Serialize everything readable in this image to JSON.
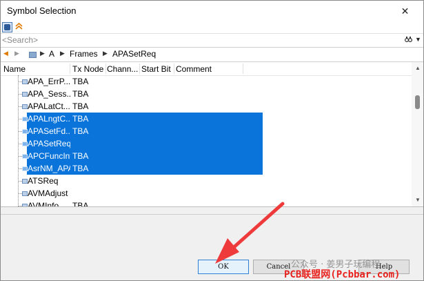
{
  "window": {
    "title": "Symbol Selection",
    "close_glyph": "✕"
  },
  "toolbar": {
    "icons": [
      "database-icon",
      "double-chevron-up-icon"
    ],
    "btn2_glyph": "≈"
  },
  "search": {
    "placeholder": "<Search>",
    "binoculars_glyph": "🔍",
    "dropdown_glyph": "▼"
  },
  "nav": {
    "back_glyph": "◀",
    "forward_glyph": "▶",
    "sep_glyph": "▶",
    "breadcrumb": [
      "A",
      "Frames",
      "APASetReq"
    ]
  },
  "columns": [
    "Name",
    "Tx Node",
    "Chann...",
    "Start Bit",
    "Comment"
  ],
  "rows": [
    {
      "name": "APA_ErrP...",
      "tx_node": "TBA",
      "selected": false
    },
    {
      "name": "APA_Sess...",
      "tx_node": "TBA",
      "selected": false
    },
    {
      "name": "APALatCt...",
      "tx_node": "TBA",
      "selected": false
    },
    {
      "name": "APALngtC...",
      "tx_node": "TBA",
      "selected": true
    },
    {
      "name": "APASetFd...",
      "tx_node": "TBA",
      "selected": true
    },
    {
      "name": "APASetReq",
      "tx_node": "",
      "selected": true
    },
    {
      "name": "APCFuncInf",
      "tx_node": "TBA",
      "selected": true
    },
    {
      "name": "AsrNM_APA",
      "tx_node": "TBA",
      "selected": true
    },
    {
      "name": "ATSReq",
      "tx_node": "",
      "selected": false
    },
    {
      "name": "AVMAdjust",
      "tx_node": "",
      "selected": false
    },
    {
      "name": "AVMInfo...",
      "tx_node": "TBA",
      "selected": false
    }
  ],
  "scrollbar": {
    "up_glyph": "▲",
    "down_glyph": "▼"
  },
  "buttons": {
    "ok": "OK",
    "cancel": "Cancel",
    "help": "Help"
  },
  "watermark": {
    "line1": "公众号 · 姜男子玩编程",
    "line2": "PCB联盟网(Pcbbar.com)"
  },
  "colors": {
    "selection": "#0a74da",
    "annotation_arrow": "#ee3a3a"
  }
}
